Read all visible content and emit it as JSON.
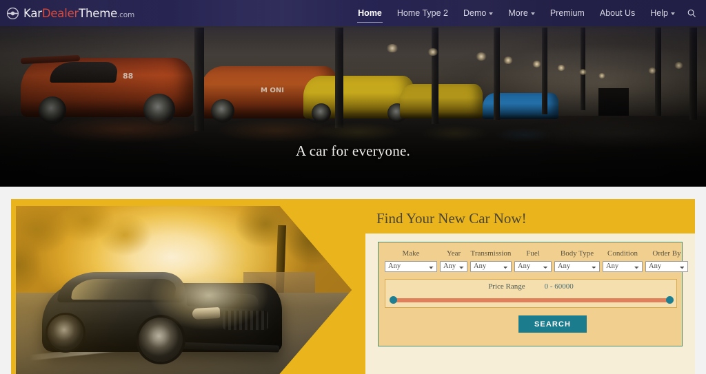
{
  "header": {
    "logo": {
      "icon": "steering-wheel-icon",
      "part1": "Kar",
      "part2": "Dealer",
      "part3": "Theme",
      "part4": ".com"
    },
    "nav": [
      {
        "label": "Home",
        "active": true,
        "caret": false
      },
      {
        "label": "Home Type 2",
        "active": false,
        "caret": false
      },
      {
        "label": "Demo",
        "active": false,
        "caret": true
      },
      {
        "label": "More",
        "active": false,
        "caret": true
      },
      {
        "label": "Premium",
        "active": false,
        "caret": false
      },
      {
        "label": "About Us",
        "active": false,
        "caret": false
      },
      {
        "label": "Help",
        "active": false,
        "caret": true
      }
    ],
    "search_icon": "search-icon",
    "background_color": "#26235 0"
  },
  "hero": {
    "caption": "A car for everyone.",
    "image_description": "Dark racing garage with orange and yellow race cars lined along a long lit corridor",
    "decals": {
      "number": "88",
      "sponsor": "M ONI"
    }
  },
  "search_section": {
    "title": "Find Your New Car Now!",
    "panel_color": "#e9b41c",
    "car_image_description": "Black Ford Mustang parked at sunset with golden backlight through trees",
    "fields": [
      {
        "label": "Make",
        "value": "Any",
        "class": "f-make"
      },
      {
        "label": "Year",
        "value": "Any",
        "class": "f-year"
      },
      {
        "label": "Transmission",
        "value": "Any",
        "class": "f-trans"
      },
      {
        "label": "Fuel",
        "value": "Any",
        "class": "f-fuel"
      },
      {
        "label": "Body Type",
        "value": "Any",
        "class": "f-body"
      },
      {
        "label": "Condition",
        "value": "Any",
        "class": "f-cond"
      },
      {
        "label": "Order By",
        "value": "Any",
        "class": "f-order"
      }
    ],
    "price": {
      "label": "Price Range",
      "value": "0 - 60000",
      "min": 0,
      "max": 60000,
      "handle_color": "#1d7f91",
      "track_color": "#e0805a"
    },
    "search_button": {
      "label": "SEARCH",
      "color": "#1a7c8c"
    }
  }
}
